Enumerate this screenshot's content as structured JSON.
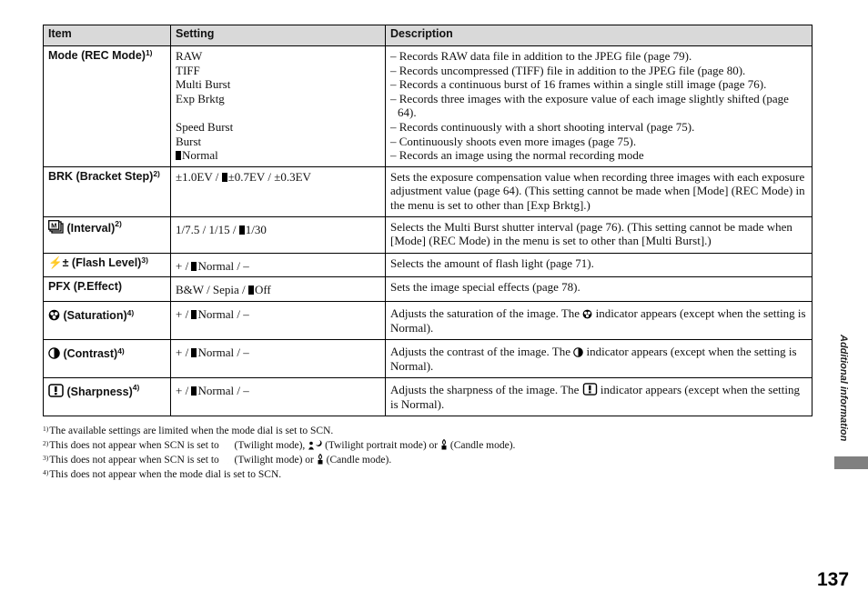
{
  "table": {
    "headers": [
      "Item",
      "Setting",
      "Description"
    ],
    "rows": [
      {
        "item": "Mode (REC Mode)",
        "note": "1)",
        "icon": null,
        "settings": [
          "RAW",
          "TIFF",
          "Multi Burst",
          "Exp Brktg",
          "",
          "Speed Burst",
          "Burst",
          "Normal"
        ],
        "default_index": 7,
        "description": [
          "– Records RAW data file in addition to the JPEG file (page 79).",
          "– Records uncompressed (TIFF) file in addition to the JPEG file (page 80).",
          "– Records a continuous burst of 16 frames within a single still image (page 76).",
          "– Records three images with the exposure value of each image slightly shifted (page 64).",
          "– Records continuously with a short shooting interval (page 75).",
          "– Continuously shoots even more images (page 75).",
          "– Records an image using the normal recording mode"
        ]
      },
      {
        "item": "BRK (Bracket Step)",
        "note": "2)",
        "icon": null,
        "setting_parts": [
          "±1.0EV / ",
          "±0.7EV",
          " / ±0.3EV"
        ],
        "description": "Sets the exposure compensation value when recording three images with each exposure adjustment value (page 64). (This setting cannot be made when [Mode] (REC Mode) in the menu is set to other than [Exp Brktg].)"
      },
      {
        "item": "(Interval)",
        "note": "2)",
        "icon": "multi-burst-icon",
        "setting_parts": [
          "1/7.5 / 1/15 / ",
          "1/30",
          ""
        ],
        "description": "Selects the Multi Burst shutter interval (page 76). (This setting cannot be made when [Mode] (REC Mode) in the menu is set to other than [Multi Burst].)"
      },
      {
        "item": "(Flash Level)",
        "note": "3)",
        "icon": "flash-level-icon",
        "icon_text": "⚡±",
        "setting_parts": [
          "+ / ",
          "Normal",
          " / –"
        ],
        "description": "Selects the amount of flash light (page 71)."
      },
      {
        "item": "PFX (P.Effect)",
        "note": "",
        "icon": null,
        "setting_parts": [
          "B&W / Sepia / ",
          "Off",
          ""
        ],
        "description": "Sets the image special effects (page 78)."
      },
      {
        "item": "(Saturation)",
        "note": "4)",
        "icon": "saturation-icon",
        "setting_parts": [
          "+ / ",
          "Normal",
          " / –"
        ],
        "description_before": "Adjusts the saturation of the image. The ",
        "description_after": " indicator appears (except when the setting is Normal)."
      },
      {
        "item": "(Contrast)",
        "note": "4)",
        "icon": "contrast-icon",
        "setting_parts": [
          "+ / ",
          "Normal",
          " / –"
        ],
        "description_before": "Adjusts the contrast of the image. The ",
        "description_after": " indicator appears (except when the setting is Normal)."
      },
      {
        "item": "(Sharpness)",
        "note": "4)",
        "icon": "sharpness-icon",
        "setting_parts": [
          "+ / ",
          "Normal",
          " / –"
        ],
        "description_before": "Adjusts the sharpness of the image. The ",
        "description_after": " indicator appears (except when the setting is Normal)."
      }
    ]
  },
  "footnotes": [
    {
      "mark": "1)",
      "text": "The available settings are limited when the mode dial is set to SCN."
    },
    {
      "mark": "2)",
      "t1": "This does not appear when SCN is set to ",
      "t2": " (Twilight mode), ",
      "t3": " (Twilight portrait mode) or ",
      "t4": " (Candle mode)."
    },
    {
      "mark": "3)",
      "t1": "This does not appear when SCN is set to ",
      "t2": " (Twilight mode) or ",
      "t3": " (Candle mode)."
    },
    {
      "mark": "4)",
      "text": "This does not appear when the mode dial is set to SCN."
    }
  ],
  "side_label": "Additional information",
  "page_number": "137"
}
